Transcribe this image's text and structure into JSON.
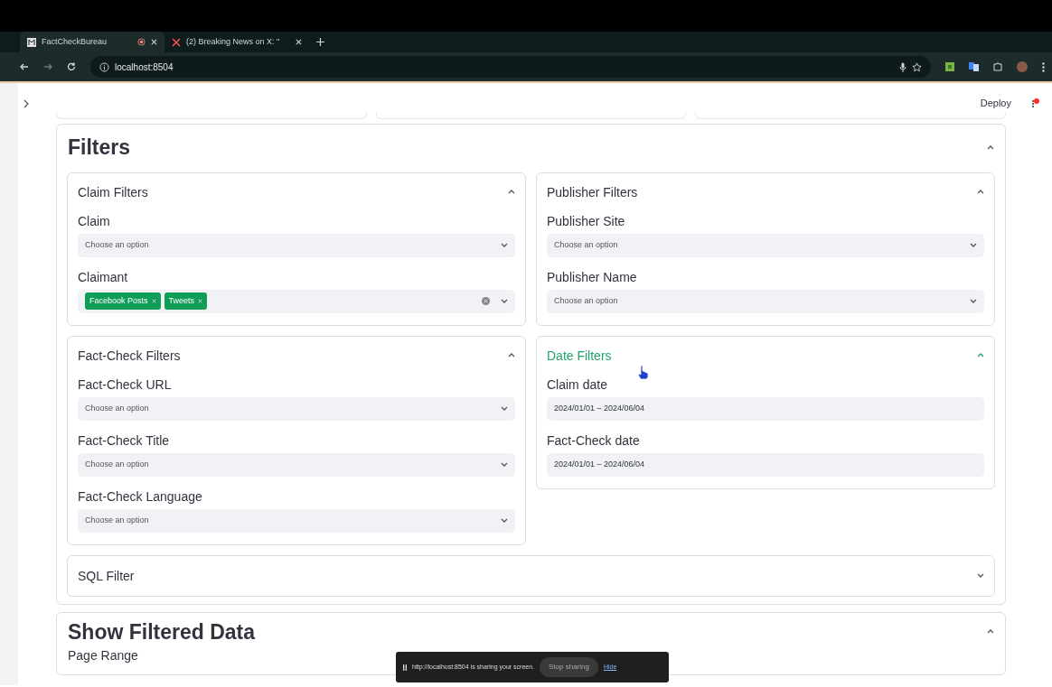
{
  "browser": {
    "tabs": [
      {
        "title": "FactCheckBureau",
        "selected": true,
        "recording": true
      },
      {
        "title": "(2) Breaking News on X: \"",
        "selected": false,
        "recording": false
      }
    ],
    "address": "localhost:8504"
  },
  "header": {
    "deploy": "Deploy"
  },
  "filters": {
    "title": "Filters",
    "expanded": true,
    "groups": [
      {
        "title": "Claim Filters",
        "expanded": true,
        "hovered": false,
        "fields": [
          {
            "kind": "select",
            "label": "Claim",
            "placeholder": "Choose an option"
          },
          {
            "kind": "multiselect",
            "label": "Claimant",
            "tags": [
              "Facebook Posts",
              "Tweets"
            ]
          }
        ]
      },
      {
        "title": "Publisher Filters",
        "expanded": true,
        "hovered": false,
        "fields": [
          {
            "kind": "select",
            "label": "Publisher Site",
            "placeholder": "Choose an option"
          },
          {
            "kind": "select",
            "label": "Publisher Name",
            "placeholder": "Choose an option"
          }
        ]
      },
      {
        "title": "Fact-Check Filters",
        "expanded": true,
        "hovered": false,
        "fields": [
          {
            "kind": "select",
            "label": "Fact-Check URL",
            "placeholder": "Choose an option"
          },
          {
            "kind": "select",
            "label": "Fact-Check Title",
            "placeholder": "Choose an option"
          },
          {
            "kind": "select",
            "label": "Fact-Check Language",
            "placeholder": "Choose an option"
          }
        ]
      },
      {
        "title": "Date Filters",
        "expanded": true,
        "hovered": true,
        "fields": [
          {
            "kind": "date",
            "label": "Claim date",
            "value": "2024/01/01 – 2024/06/04"
          },
          {
            "kind": "date",
            "label": "Fact-Check date",
            "value": "2024/01/01 – 2024/06/04"
          }
        ]
      }
    ],
    "sql_filter": {
      "title": "SQL Filter",
      "expanded": false
    }
  },
  "show_data": {
    "title": "Show Filtered Data",
    "expanded": true,
    "field_label": "Page Range"
  },
  "share_bar": {
    "message": "http://localhost:8504 is sharing your screen.",
    "stop": "Stop sharing",
    "hide": "Hide"
  }
}
